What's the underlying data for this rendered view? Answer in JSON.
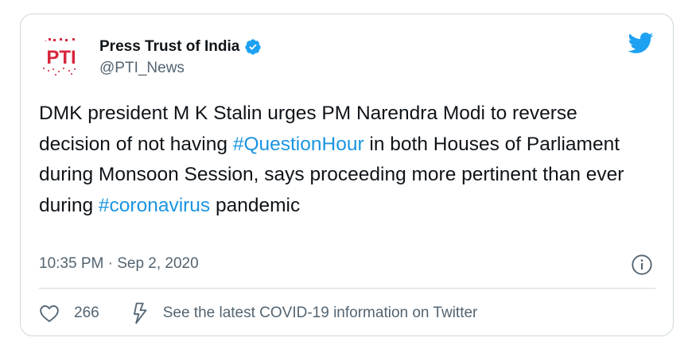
{
  "author": {
    "name": "Press Trust of India",
    "handle": "@PTI_News",
    "logo_text": "PTI",
    "verified": true
  },
  "tweet": {
    "text_before_tag1": "DMK president M K Stalin urges PM Narendra Modi to reverse decision of not having ",
    "hashtag1": "#QuestionHour",
    "text_between": " in both Houses of Parliament during Monsoon Session, says proceeding more pertinent than ever during ",
    "hashtag2": "#coronavirus",
    "text_after": " pandemic"
  },
  "meta": {
    "timestamp": "10:35 PM · Sep 2, 2020"
  },
  "actions": {
    "like_count": "266",
    "covid_info_label": "See the latest COVID-19 information on Twitter"
  },
  "icons": {
    "brand": "twitter-bird-icon",
    "verified": "verified-badge-icon",
    "info": "info-icon",
    "like": "heart-icon",
    "covid": "lightning-bolt-icon"
  },
  "colors": {
    "twitter_blue": "#1da1f2",
    "hashtag": "#1b95e0",
    "text": "#0f1419",
    "secondary": "#536471",
    "border": "#cfd9de",
    "logo_red": "#d7263d"
  }
}
